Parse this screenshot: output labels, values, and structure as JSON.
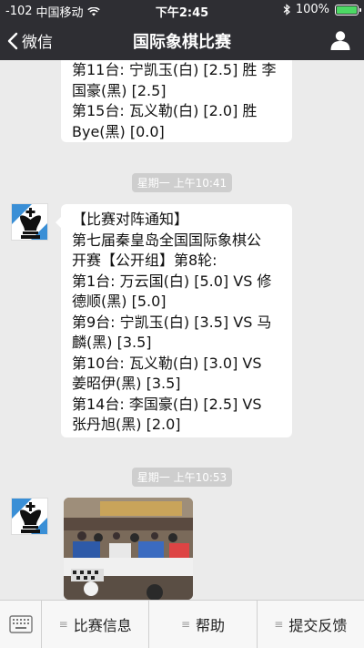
{
  "status_bar": {
    "signal": "-102",
    "carrier": "中国移动",
    "time": "下午2:45",
    "battery": "100%"
  },
  "nav": {
    "back_label": "微信",
    "title": "国际象棋比赛"
  },
  "messages": [
    {
      "lines": [
        "第11台: 宁凯玉(白) [2.5] 胜 李",
        "国豪(黑) [2.5]",
        "第15台: 瓦义勒(白) [2.0] 胜",
        "Bye(黑) [0.0]"
      ]
    },
    {
      "timestamp": "星期一 上午10:41",
      "lines": [
        "【比赛对阵通知】",
        "第七届秦皇岛全国国际象棋公",
        "开赛【公开组】第8轮:",
        "第1台: 万云国(白) [5.0] VS 修",
        "德顺(黑) [5.0]",
        "第9台: 宁凯玉(白) [3.5] VS 马",
        "麟(黑) [3.5]",
        "第10台: 瓦义勒(白) [3.0] VS",
        "姜昭伊(黑) [3.5]",
        "第14台: 李国豪(白) [2.5] VS",
        "张丹旭(黑) [2.0]"
      ]
    },
    {
      "timestamp": "星期一 上午10:53",
      "type": "photo"
    }
  ],
  "menu": {
    "items": [
      {
        "label": "比赛信息",
        "icon": "menu-lines-icon"
      },
      {
        "label": "帮助",
        "icon": "menu-lines-icon"
      },
      {
        "label": "提交反馈",
        "icon": "menu-lines-icon"
      }
    ]
  },
  "colors": {
    "nav_bg": "#2e2e33",
    "chat_bg": "#ebebeb",
    "battery_green": "#4cd964"
  }
}
